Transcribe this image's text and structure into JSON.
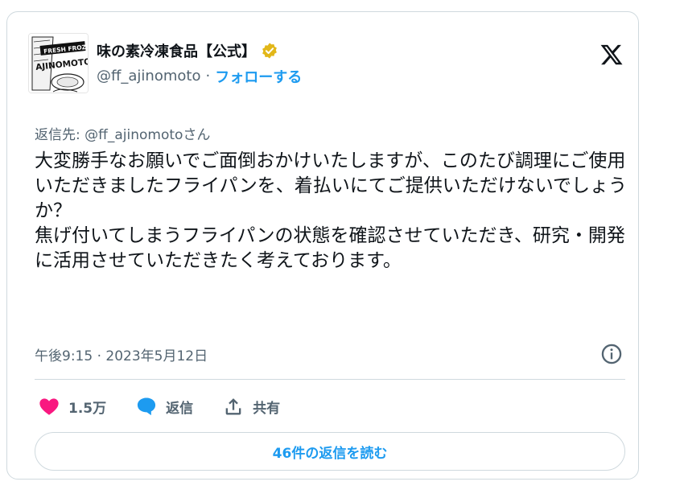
{
  "account": {
    "display_name": "味の素冷凍食品【公式】",
    "handle": "@ff_ajinomoto",
    "separator": "·",
    "follow_label": "フォローする",
    "avatar_text_top": "FRESH FROZEN",
    "avatar_text_brand": "AJINOMOTO",
    "badge_color": "#e2b719",
    "badge_icon": "verified-badge-icon"
  },
  "tweet": {
    "reply_to": "返信先: @ff_ajinomotoさん",
    "text": "大変勝手なお願いでご面倒おかけいたしますが、このたび調理にご使用いただきましたフライパンを、着払いにてご提供いただけないでしょうか？\n焦げ付いてしまうフライパンの状態を確認させていただき、研究・開発に活用させていただきたく考えております。",
    "timestamp": "午後9:15 · 2023年5月12日"
  },
  "actions": {
    "like_count": "1.5万",
    "reply_label": "返信",
    "share_label": "共有",
    "like_color": "#f91880",
    "reply_color": "#1d9bf0"
  },
  "read_replies_label": "46件の返信を読む",
  "icons": {
    "logo": "x-logo-icon",
    "info": "info-icon",
    "like": "heart-icon",
    "reply": "speech-bubble-icon",
    "share": "share-upload-icon"
  }
}
